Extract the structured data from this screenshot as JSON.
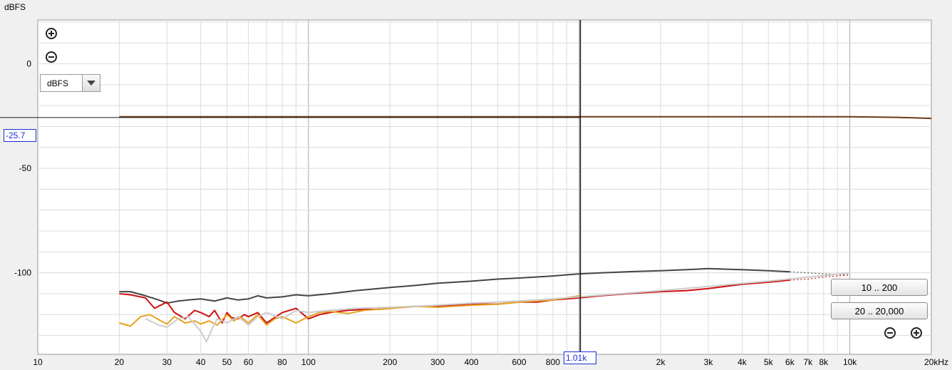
{
  "y_axis_unit": "dBFS",
  "unit_selector": {
    "value": "dBFS"
  },
  "readouts": {
    "y": "-25.7",
    "x": "1.01k"
  },
  "buttons": {
    "range_a": "10 .. 200",
    "range_b": "20 .. 20,000"
  },
  "icons": {
    "zoom_in_top": "zoom-in-icon",
    "zoom_out_top": "zoom-out-icon",
    "zoom_out_bottom": "zoom-out-icon",
    "zoom_in_bottom": "zoom-in-icon",
    "dropdown": "chevron-down-icon"
  },
  "colors": {
    "plot_bg": "#ffffff",
    "grid_minor": "#dcdcdc",
    "grid_major": "#a8a8a8",
    "cursor": "#1a1a1a",
    "readout": "#1a2fd8"
  },
  "chart_data": {
    "type": "line",
    "xscale": "log",
    "xlim": [
      10,
      20000
    ],
    "ylim": [
      -139,
      21
    ],
    "ylabel": "dBFS",
    "xunit": "kHz",
    "yticks": [
      {
        "value": 0,
        "label": "0"
      },
      {
        "value": -50,
        "label": "-50"
      },
      {
        "value": -100,
        "label": "-100"
      }
    ],
    "xticks": [
      {
        "value": 10,
        "label": "10"
      },
      {
        "value": 20,
        "label": "20"
      },
      {
        "value": 30,
        "label": "30"
      },
      {
        "value": 40,
        "label": "40"
      },
      {
        "value": 50,
        "label": "50"
      },
      {
        "value": 60,
        "label": "60"
      },
      {
        "value": 80,
        "label": "80"
      },
      {
        "value": 100,
        "label": "100"
      },
      {
        "value": 200,
        "label": "200"
      },
      {
        "value": 300,
        "label": "300"
      },
      {
        "value": 400,
        "label": "400"
      },
      {
        "value": 600,
        "label": "600"
      },
      {
        "value": 800,
        "label": "800"
      },
      {
        "value": 2000,
        "label": "2k"
      },
      {
        "value": 3000,
        "label": "3k"
      },
      {
        "value": 4000,
        "label": "4k"
      },
      {
        "value": 5000,
        "label": "5k"
      },
      {
        "value": 6000,
        "label": "6k"
      },
      {
        "value": 7000,
        "label": "7k"
      },
      {
        "value": 8000,
        "label": "8k"
      },
      {
        "value": 10000,
        "label": "10k"
      },
      {
        "value": 20000,
        "label": "20kHz"
      }
    ],
    "major_gridlines_x": [
      10,
      100,
      1000,
      10000
    ],
    "cursor": {
      "x": 1010,
      "y": -25.7
    },
    "grid": true,
    "series": [
      {
        "color": "#6b3a1a",
        "width": 2,
        "x": [
          20,
          50,
          100,
          200,
          500,
          1000,
          2000,
          5000,
          10000,
          15000,
          20000
        ],
        "y": [
          -25.3,
          -25.3,
          -25.3,
          -25.3,
          -25.3,
          -25.3,
          -25.3,
          -25.3,
          -25.3,
          -25.6,
          -26.1
        ]
      },
      {
        "color": "#444444",
        "width": 2,
        "x": [
          20,
          22,
          25,
          28,
          30,
          33,
          36,
          40,
          45,
          50,
          55,
          60,
          65,
          70,
          80,
          90,
          100,
          120,
          150,
          200,
          250,
          300,
          400,
          500,
          600,
          700,
          800,
          1000,
          1200,
          1500,
          2000,
          2500,
          3000,
          4000,
          5000,
          6000
        ],
        "y": [
          -109,
          -109,
          -111,
          -113,
          -114.5,
          -113.5,
          -113,
          -112.5,
          -113.5,
          -112,
          -113,
          -112.5,
          -111,
          -112,
          -111.5,
          -110.5,
          -111,
          -110,
          -108.5,
          -107,
          -106,
          -105,
          -104,
          -103,
          -102.5,
          -102,
          -101.5,
          -100.5,
          -100,
          -99.5,
          -99,
          -98.5,
          -98,
          -98.5,
          -99,
          -99.5
        ]
      },
      {
        "color": "#555555",
        "width": 1.2,
        "dashed": true,
        "x": [
          6000,
          7000,
          8000,
          10000
        ],
        "y": [
          -99.5,
          -100,
          -100.5,
          -101
        ]
      },
      {
        "color": "#cc1111",
        "width": 2,
        "x": [
          20,
          22,
          25,
          27,
          30,
          32,
          35,
          38,
          40,
          43,
          45,
          48,
          50,
          52,
          55,
          58,
          60,
          65,
          70,
          80,
          90,
          100,
          110,
          120,
          140,
          160,
          180,
          200,
          250,
          300,
          400,
          500,
          600,
          700,
          800,
          1000,
          1200,
          1500,
          2000,
          2500,
          3000,
          4000,
          5000,
          6000
        ],
        "y": [
          -110,
          -110.5,
          -112,
          -117,
          -114,
          -119,
          -122,
          -118,
          -119,
          -121,
          -118,
          -124,
          -119,
          -121.5,
          -122,
          -120,
          -121,
          -119,
          -124,
          -119,
          -117,
          -122,
          -120,
          -119,
          -118,
          -117.5,
          -117.5,
          -117,
          -116,
          -116,
          -115,
          -115,
          -114,
          -114,
          -113,
          -112,
          -111,
          -110,
          -109,
          -108.5,
          -107.5,
          -105.5,
          -104.5,
          -103.5
        ]
      },
      {
        "color": "#cc1111",
        "width": 1.2,
        "dashed": true,
        "x": [
          6000,
          7000,
          8000,
          10000
        ],
        "y": [
          -103.5,
          -103,
          -102,
          -101
        ]
      },
      {
        "color": "#e8a020",
        "width": 2,
        "x": [
          20,
          22,
          24,
          26,
          28,
          30,
          32,
          35,
          38,
          40,
          43,
          46,
          50,
          53,
          56,
          60,
          65,
          70,
          75,
          80,
          90,
          100,
          110,
          120,
          140,
          160,
          200,
          250,
          300,
          400,
          500,
          600,
          800,
          1000
        ],
        "y": [
          -124,
          -125.5,
          -121,
          -120,
          -122.5,
          -124.5,
          -121,
          -124,
          -123,
          -124.5,
          -123,
          -125,
          -120,
          -123,
          -121,
          -124,
          -120,
          -125,
          -122,
          -121,
          -124,
          -121,
          -119,
          -118.5,
          -119.5,
          -118,
          -117,
          -116,
          -116.5,
          -115.5,
          -115,
          -114,
          -113,
          -111
        ]
      },
      {
        "color": "#cccccc",
        "width": 2,
        "x": [
          25,
          28,
          30,
          33,
          36,
          40,
          42,
          44,
          46,
          50,
          55,
          60,
          65,
          70,
          80,
          90,
          100,
          120,
          150,
          200,
          300,
          400,
          500,
          700,
          1000,
          2000,
          3000,
          5000,
          10000
        ],
        "y": [
          -122,
          -125,
          -126,
          -122,
          -121,
          -128,
          -133,
          -127,
          -122,
          -124,
          -121,
          -125,
          -121,
          -119,
          -122,
          -118,
          -119,
          -118,
          -117,
          -116.5,
          -115.5,
          -114.5,
          -114,
          -113,
          -111.5,
          -108.5,
          -106.5,
          -104,
          -100
        ]
      }
    ]
  }
}
